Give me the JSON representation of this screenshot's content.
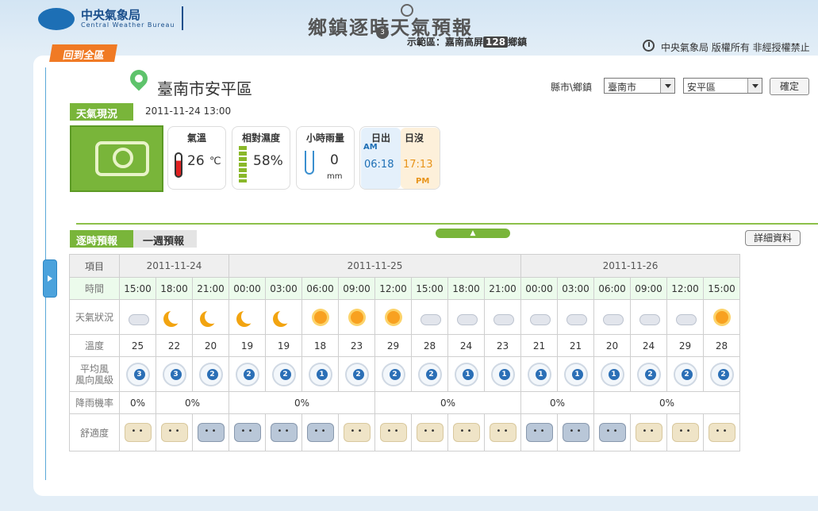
{
  "header": {
    "logo_cn": "中央氣象局",
    "logo_en": "Central Weather Bureau",
    "banner_title": "鄉鎮逐時天氣預報",
    "banner_deco_num": "3",
    "banner_sub_prefix": "示範區：嘉南高屏",
    "banner_sub_count": "128",
    "banner_sub_suffix": "鄉鎮",
    "copyright": "中央氣象局 版權所有 非經授權禁止"
  },
  "nav": {
    "back_all": "回到全區"
  },
  "location": {
    "name": "臺南市安平區"
  },
  "selector": {
    "label": "縣市\\鄉鎮",
    "county": "臺南市",
    "town": "安平區",
    "confirm": "確定"
  },
  "current": {
    "tab": "天氣現況",
    "time": "2011-11-24 13:00",
    "temp_label": "氣溫",
    "temp_value": "26",
    "temp_unit": "℃",
    "humidity_label": "相對濕度",
    "humidity_value": "58%",
    "rain_label": "小時雨量",
    "rain_value": "0",
    "rain_unit": "mm",
    "sunrise_label": "日出",
    "sunset_label": "日沒",
    "am_label": "AM",
    "pm_label": "PM",
    "sunrise_time": "06:18",
    "sunset_time": "17:13"
  },
  "forecast": {
    "tab_hourly": "逐時預報",
    "tab_weekly": "一週預報",
    "detail_button": "詳細資料",
    "collapse_label": "▲",
    "labels": {
      "item": "項目",
      "time": "時間",
      "weather": "天氣狀況",
      "temp": "溫度",
      "wind": "平均風\n風向風級",
      "rain": "降雨機率",
      "comfort": "舒適度"
    },
    "dates": [
      {
        "label": "2011-11-24",
        "span": 3
      },
      {
        "label": "2011-11-25",
        "span": 8
      },
      {
        "label": "2011-11-26",
        "span": 6
      }
    ],
    "times": [
      "15:00",
      "18:00",
      "21:00",
      "00:00",
      "03:00",
      "06:00",
      "09:00",
      "12:00",
      "15:00",
      "18:00",
      "21:00",
      "00:00",
      "03:00",
      "06:00",
      "09:00",
      "12:00",
      "15:00"
    ],
    "weather": [
      "cloudy-icon",
      "moon-icon",
      "moon-icon",
      "moon-icon",
      "moon-icon",
      "sun-icon",
      "sun-icon",
      "sun-icon",
      "cloudy-icon",
      "cloudy-icon",
      "cloudy-icon",
      "cloudy-icon",
      "cloudy-icon",
      "cloudy-icon",
      "cloudy-icon",
      "cloudy-icon",
      "sun-icon"
    ],
    "temps": [
      "25",
      "22",
      "20",
      "19",
      "19",
      "18",
      "23",
      "29",
      "28",
      "24",
      "23",
      "21",
      "21",
      "20",
      "24",
      "29",
      "28"
    ],
    "wind": [
      "3",
      "3",
      "2",
      "2",
      "2",
      "1",
      "2",
      "2",
      "2",
      "1",
      "1",
      "1",
      "1",
      "1",
      "2",
      "2",
      "2"
    ],
    "rain": [
      {
        "label": "0%",
        "span": 1
      },
      {
        "label": "0%",
        "span": 2
      },
      {
        "label": "0%",
        "span": 4
      },
      {
        "label": "0%",
        "span": 4
      },
      {
        "label": "0%",
        "span": 2
      },
      {
        "label": "0%",
        "span": 4
      }
    ],
    "comfort": [
      "pleasant",
      "pleasant",
      "cool",
      "cool",
      "cool",
      "cool",
      "pleasant",
      "pleasant",
      "pleasant",
      "pleasant",
      "pleasant",
      "cool",
      "cool",
      "cool",
      "pleasant",
      "pleasant",
      "pleasant"
    ]
  }
}
